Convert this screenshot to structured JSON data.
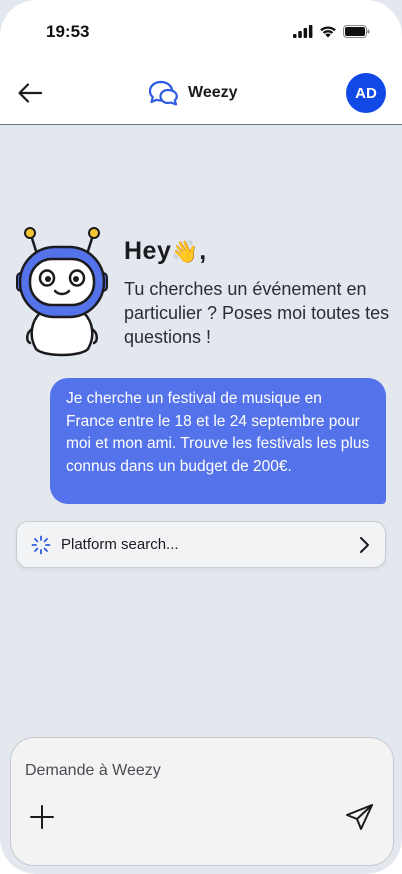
{
  "status_bar": {
    "time": "19:53"
  },
  "header": {
    "title": "Weezy",
    "avatar_initials": "AD"
  },
  "welcome": {
    "greeting": "Hey",
    "greeting_emoji": "👋",
    "greeting_suffix": ",",
    "text": "Tu cherches un événement en particulier ? Poses moi toutes tes questions !"
  },
  "messages": [
    {
      "role": "user",
      "text": "Je cherche un festival de musique en France entre le 18 et le 24 septembre pour moi et mon ami. Trouve les festivals les plus connus dans un budget de 200€."
    }
  ],
  "platform_search": {
    "label": "Platform search..."
  },
  "composer": {
    "placeholder": "Demande à Weezy"
  },
  "colors": {
    "accent": "#1149e6",
    "bubble": "#5472ea",
    "background": "#e3e7ee"
  }
}
